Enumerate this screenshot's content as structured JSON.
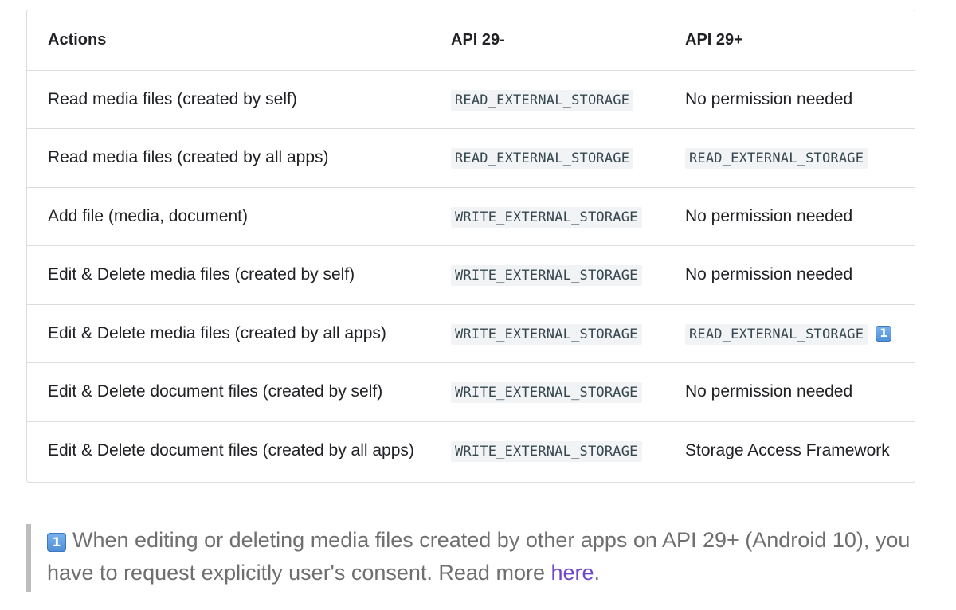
{
  "table": {
    "headers": [
      "Actions",
      "API 29-",
      "API 29+"
    ],
    "rows": [
      {
        "action": "Read media files (created by self)",
        "api_old": "READ_EXTERNAL_STORAGE",
        "api_new": "No permission needed"
      },
      {
        "action": "Read media files (created by all apps)",
        "api_old": "READ_EXTERNAL_STORAGE",
        "api_new": "READ_EXTERNAL_STORAGE"
      },
      {
        "action": "Add file (media, document)",
        "api_old": "WRITE_EXTERNAL_STORAGE",
        "api_new": "No permission needed"
      },
      {
        "action": "Edit & Delete media files (created by self)",
        "api_old": "WRITE_EXTERNAL_STORAGE",
        "api_new": "No permission needed"
      },
      {
        "action": "Edit & Delete media files (created by all apps)",
        "api_old": "WRITE_EXTERNAL_STORAGE",
        "api_new": "READ_EXTERNAL_STORAGE",
        "api_new_note": "1"
      },
      {
        "action": "Edit & Delete document files (created by self)",
        "api_old": "WRITE_EXTERNAL_STORAGE",
        "api_new": "No permission needed"
      },
      {
        "action": "Edit & Delete document files (created by all apps)",
        "api_old": "WRITE_EXTERNAL_STORAGE",
        "api_new": "Storage Access Framework"
      }
    ]
  },
  "note": {
    "marker": "1",
    "text": "When editing or deleting media files created by other apps on API 29+ (Android 10), you have to request explicitly user's consent. Read more ",
    "link_text": "here",
    "suffix": "."
  },
  "colors": {
    "border": "#dadce0",
    "code_bg": "#f1f3f4",
    "link": "#7247c7",
    "note_text": "#6f6f6f",
    "note_bar": "#bdbdbd",
    "badge": "#4f8fd6"
  }
}
